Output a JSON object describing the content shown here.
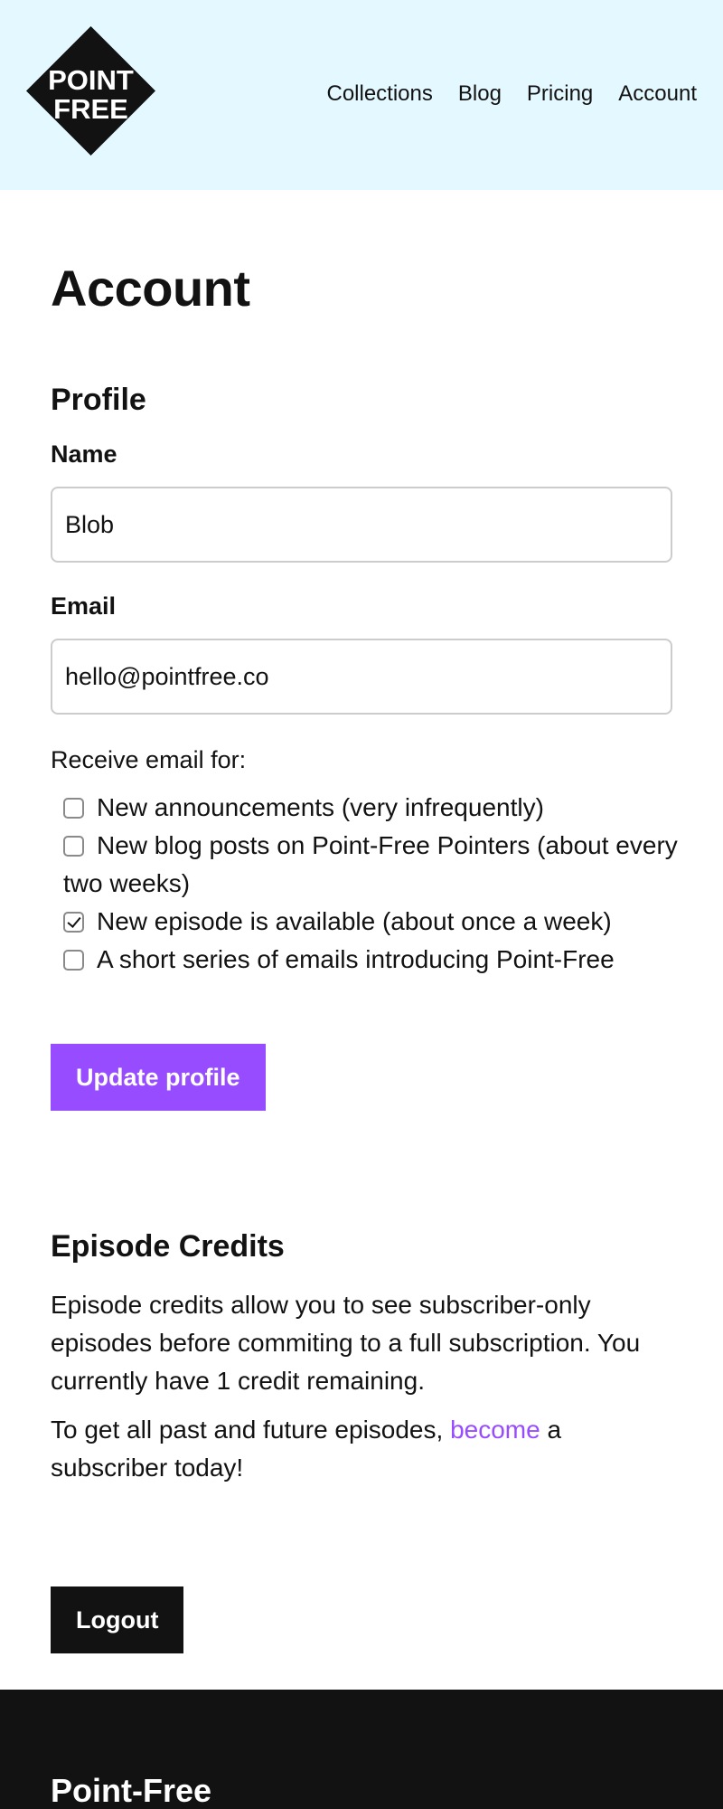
{
  "header": {
    "logo": {
      "line1": "POINT",
      "line2": "FREE"
    },
    "nav": [
      "Collections",
      "Blog",
      "Pricing",
      "Account"
    ]
  },
  "page": {
    "title": "Account"
  },
  "profile": {
    "heading": "Profile",
    "name_label": "Name",
    "name_value": "Blob",
    "email_label": "Email",
    "email_value": "hello@pointfree.co",
    "receive_label": "Receive email for:",
    "preferences": [
      {
        "label": "New announcements (very infrequently)",
        "checked": false
      },
      {
        "label": "New blog posts on Point-Free Pointers (about every two weeks)",
        "checked": false
      },
      {
        "label": "New episode is available (about once a week)",
        "checked": true
      },
      {
        "label": "A short series of emails introducing Point-Free",
        "checked": false
      }
    ],
    "update_button": "Update profile"
  },
  "credits": {
    "heading": "Episode Credits",
    "description": "Episode credits allow you to see subscriber-only episodes before commiting to a full subscription. You currently have 1 credit remaining.",
    "cta_before": "To get all past and future episodes, ",
    "cta_link": "become",
    "cta_after": " a subscriber today!"
  },
  "logout_button": "Logout",
  "footer": {
    "brand": "Point-Free"
  },
  "colors": {
    "header_bg": "#e4f8ff",
    "accent": "#974dff",
    "dark": "#121212"
  }
}
